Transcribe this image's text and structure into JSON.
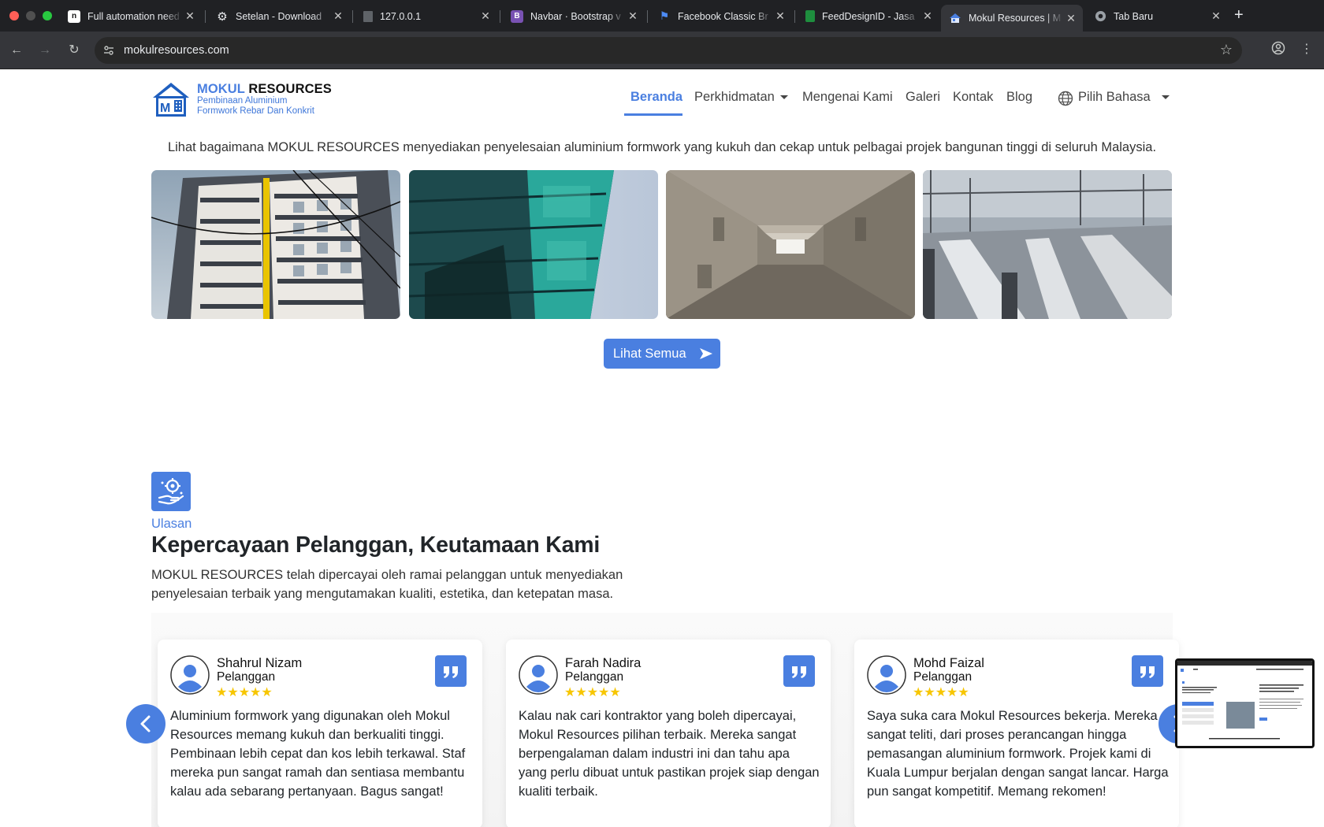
{
  "browser": {
    "tabs": [
      {
        "title": "Full automation need",
        "favicon": "n8n-icon"
      },
      {
        "title": "Setelan - Download",
        "favicon": "gear-icon"
      },
      {
        "title": "127.0.0.1",
        "favicon": "page-icon"
      },
      {
        "title": "Navbar · Bootstrap v",
        "favicon": "bootstrap-icon"
      },
      {
        "title": "Facebook Classic Br",
        "favicon": "flag-icon"
      },
      {
        "title": "FeedDesignID - Jasa",
        "favicon": "sheets-icon"
      },
      {
        "title": "Mokul Resources | M",
        "favicon": "house-icon",
        "active": true
      },
      {
        "title": "Tab Baru",
        "favicon": "chrome-icon"
      }
    ],
    "url": "mokulresources.com"
  },
  "site": {
    "brand": {
      "name_accent": "MOKUL",
      "name_rest": " RESOURCES",
      "tagline_1": "Pembinaan Aluminium",
      "tagline_2": "Formwork Rebar Dan Konkrit"
    },
    "nav": {
      "home": "Beranda",
      "services": "Perkhidmatan",
      "about": "Mengenai Kami",
      "gallery": "Galeri",
      "contact": "Kontak",
      "blog": "Blog",
      "language": "Pilih Bahasa"
    },
    "gallery": {
      "intro": "Lihat bagaimana MOKUL RESOURCES menyediakan penyelesaian aluminium formwork yang kukuh dan cekap untuk pelbagai projek bangunan tinggi di seluruh Malaysia.",
      "view_all": "Lihat Semua"
    },
    "reviews": {
      "eyebrow": "Ulasan",
      "title": "Kepercayaan Pelanggan, Keutamaan Kami",
      "desc": "MOKUL RESOURCES telah dipercayai oleh ramai pelanggan untuk menyediakan penyelesaian terbaik yang mengutamakan kualiti, estetika, dan ketepatan masa.",
      "items": [
        {
          "name": "Shahrul Nizam",
          "role": "Pelanggan",
          "rating": 5,
          "stars": "★★★★★",
          "text": "Aluminium formwork yang digunakan oleh Mokul Resources memang kukuh dan berkualiti tinggi. Pembinaan lebih cepat dan kos lebih terkawal. Staf mereka pun sangat ramah dan sentiasa membantu kalau ada sebarang pertanyaan. Bagus sangat!"
        },
        {
          "name": "Farah Nadira",
          "role": "Pelanggan",
          "rating": 5,
          "stars": "★★★★★",
          "text": "Kalau nak cari kontraktor yang boleh dipercayai, Mokul Resources pilihan terbaik. Mereka sangat berpengalaman dalam industri ini dan tahu apa yang perlu dibuat untuk pastikan projek siap dengan kualiti terbaik."
        },
        {
          "name": "Mohd Faizal",
          "role": "Pelanggan",
          "rating": 5,
          "stars": "★★★★★",
          "text": "Saya suka cara Mokul Resources bekerja. Mereka sangat teliti, dari proses perancangan hingga pemasangan aluminium formwork. Projek kami di Kuala Lumpur berjalan dengan sangat lancar. Harga pun sangat kompetitif. Memang rekomen!"
        }
      ]
    },
    "colors": {
      "accent": "#4a7fe0",
      "star": "#f7c600"
    }
  }
}
